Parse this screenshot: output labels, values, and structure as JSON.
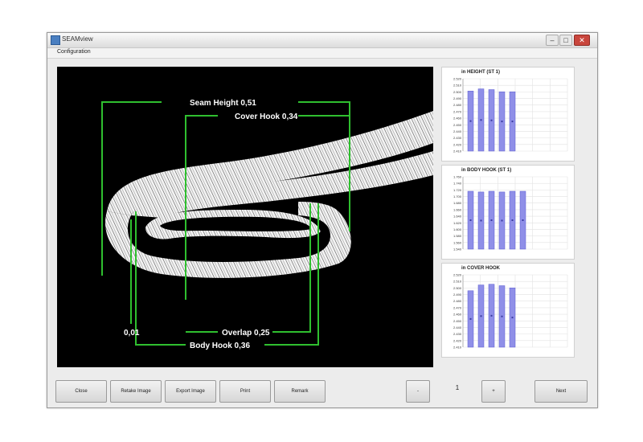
{
  "window": {
    "title": "SEAMview"
  },
  "menu": {
    "items": [
      "Configuration"
    ]
  },
  "image": {
    "labels": {
      "seam_height": "Seam Height 0,51",
      "cover_hook": "Cover Hook 0,34",
      "overlap": "Overlap 0,25",
      "body_hook": "Body Hook 0,36",
      "left_value": "0,01"
    },
    "colors": {
      "background": "#000000",
      "measure_lines": "#2fbf2f",
      "seam": "#ffffff"
    }
  },
  "charts": [
    {
      "title": "in HEIGHT (ST 1)",
      "y_ticks": [
        "2.520",
        "2.510",
        "2.500",
        "2.490",
        "2.480",
        "2.470",
        "2.460",
        "2.450",
        "2.440",
        "2.430",
        "2.420",
        "2.410"
      ],
      "values": [
        0.83,
        0.86,
        0.85,
        0.82,
        0.82
      ]
    },
    {
      "title": "in BODY HOOK (ST 1)",
      "y_ticks": [
        "1.760",
        "1.740",
        "1.720",
        "1.700",
        "1.680",
        "1.660",
        "1.640",
        "1.620",
        "1.600",
        "1.580",
        "1.560",
        "1.540"
      ],
      "values": [
        0.8,
        0.79,
        0.8,
        0.79,
        0.8,
        0.8
      ]
    },
    {
      "title": "in COVER HOOK",
      "y_ticks": [
        "2.520",
        "2.510",
        "2.500",
        "2.490",
        "2.480",
        "2.470",
        "2.460",
        "2.450",
        "2.440",
        "2.430",
        "2.420",
        "2.410"
      ],
      "values": [
        0.78,
        0.86,
        0.87,
        0.85,
        0.82
      ]
    }
  ],
  "footer": {
    "close_label": "Close",
    "retake_label": "Retake Image",
    "export_label": "Export Image",
    "print_label": "Print",
    "remark_label": "Remark",
    "prev_label": "-",
    "page_number": "1",
    "next_page_label": "+",
    "next_label": "Next"
  },
  "accent_colors": {
    "bar_fill": "#8f8fe8",
    "bar_border": "#5a5ad0"
  }
}
